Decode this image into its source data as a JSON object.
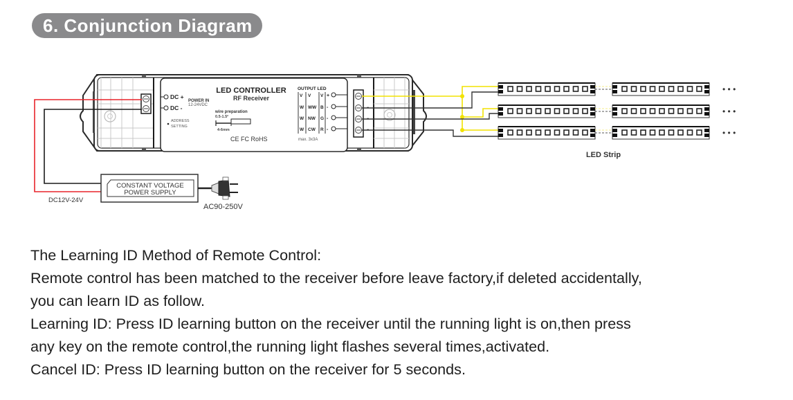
{
  "section": {
    "title": "6. Conjunction Diagram"
  },
  "diagram": {
    "controller": {
      "title": "LED CONTROLLER",
      "subtitle": "RF Receiver",
      "dc_plus": "DC +",
      "dc_minus": "DC -",
      "power_in_label": "POWER IN",
      "power_in_range": "12-24VDC",
      "address_label_1": "ADDRESS",
      "address_label_2": "SETTING",
      "wire_prep_label": "wire preparation",
      "wire_prep_size": "0.5-1.5²",
      "wire_strip_length": "4-6mm",
      "certifications": "CE FC RoHS",
      "output_title": "OUTPUT LED",
      "output_columns": [
        [
          "V",
          "W",
          "W",
          "W"
        ],
        [
          "V",
          "WW",
          "NW",
          "CW"
        ],
        [
          "V",
          "B",
          "G",
          "R"
        ]
      ],
      "output_signs": [
        "+",
        "-",
        "-",
        "-"
      ],
      "max_current": "max. 3x3A"
    },
    "terminal_signs": [
      "-",
      "-",
      "-"
    ],
    "power_supply": {
      "line1": "CONSTANT VOLTAGE",
      "line2": "POWER SUPPLY",
      "dc_label": "DC12V-24V",
      "ac_label": "AC90-250V"
    },
    "led_strip": {
      "label": "LED Strip",
      "rows": 3,
      "segments_per_row": 2,
      "leds_per_segment": 9,
      "continuation": "•  •  •"
    },
    "colors": {
      "positive_wire": "#e8232a",
      "negative_wire": "#1a1a1a",
      "led_wire": "#f2e200",
      "title_bg": "#8a8a8c"
    }
  },
  "instructions": {
    "heading": "The Learning ID Method of Remote Control:",
    "line1": "Remote control has been matched to the receiver before leave factory,if deleted accidentally,",
    "line2": "you can learn ID as follow.",
    "line3": "Learning ID: Press ID learning button on the receiver until the running light is on,then press",
    "line4": "any key on the remote control,the running light flashes several times,activated.",
    "line5": "Cancel ID: Press ID learning button on the receiver for 5 seconds."
  }
}
